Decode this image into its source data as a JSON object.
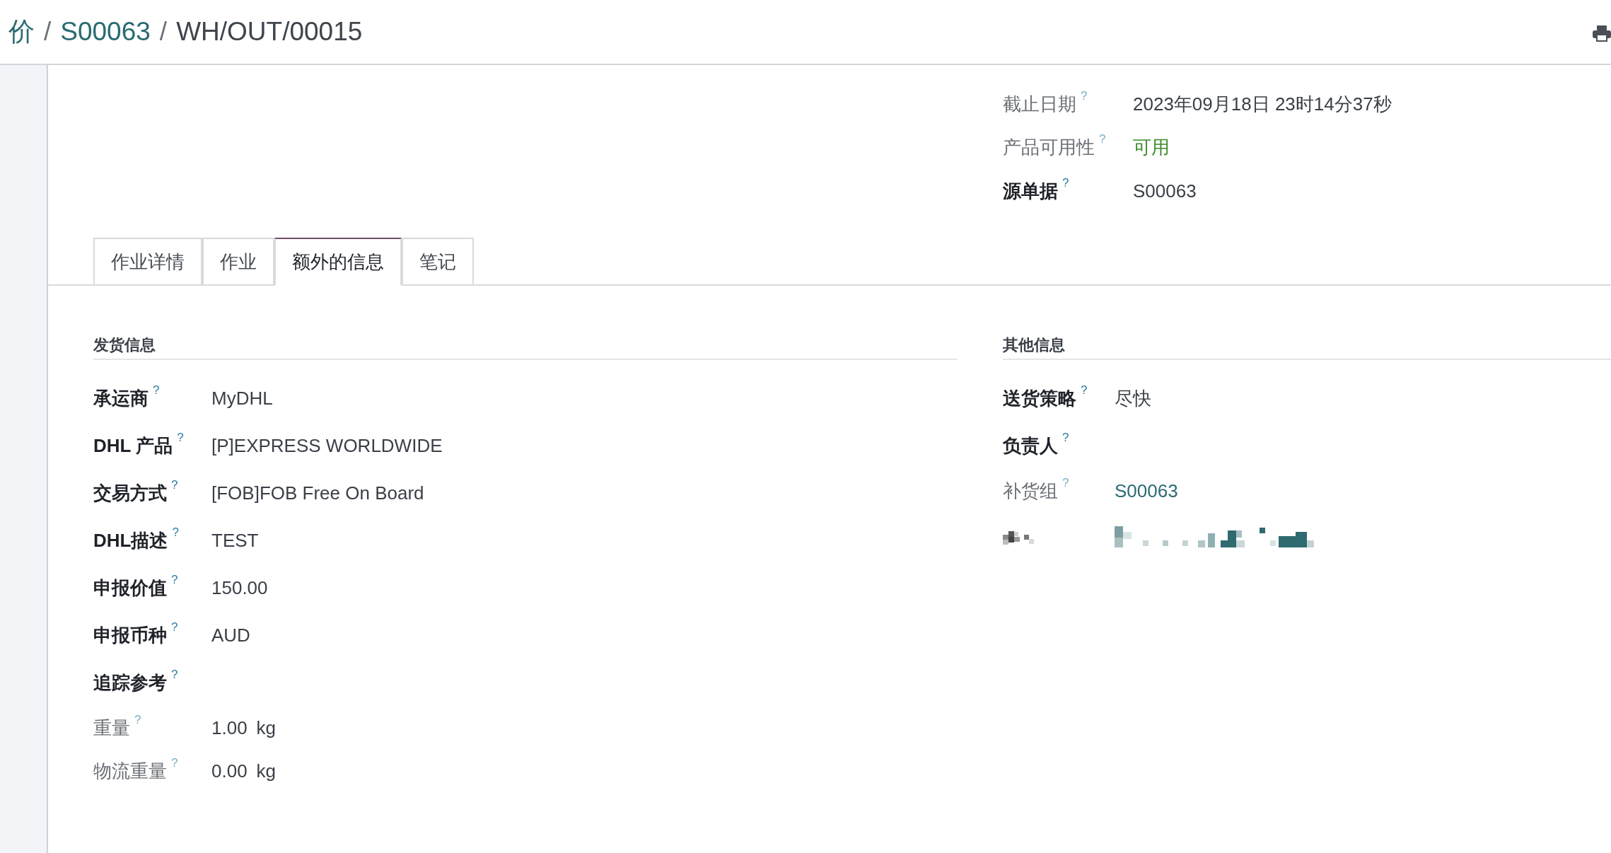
{
  "breadcrumbs": [
    {
      "kind": "link",
      "label": "价"
    },
    {
      "kind": "separator",
      "label": "/"
    },
    {
      "kind": "link",
      "label": "S00063"
    },
    {
      "kind": "separator",
      "label": "/"
    },
    {
      "kind": "current",
      "label": "WH/OUT/00015"
    }
  ],
  "header_fields": [
    {
      "kind": "text",
      "label": "截止日期",
      "tooltip": "?",
      "readonly": true,
      "value": "2023年09月18日 23时14分37秒"
    },
    {
      "kind": "status",
      "label": "产品可用性",
      "tooltip": "?",
      "readonly": true,
      "value": "可用"
    },
    {
      "kind": "text",
      "label": "源单据",
      "tooltip": "?",
      "readonly": false,
      "value": "S00063"
    }
  ],
  "tabs": [
    {
      "label": "作业详情",
      "selected": false
    },
    {
      "label": "作业",
      "selected": false
    },
    {
      "label": "额外的信息",
      "selected": true
    },
    {
      "label": "笔记",
      "selected": false
    }
  ],
  "sections": [
    {
      "title": "发货信息",
      "fields": [
        {
          "kind": "text",
          "label": "承运商",
          "tooltip": "?",
          "readonly": false,
          "value": "MyDHL"
        },
        {
          "kind": "text",
          "label": "DHL 产品",
          "tooltip": "?",
          "readonly": false,
          "value": "[P]EXPRESS WORLDWIDE"
        },
        {
          "kind": "text",
          "label": "交易方式",
          "tooltip": "?",
          "readonly": false,
          "value": "[FOB]FOB Free On Board"
        },
        {
          "kind": "text",
          "label": "DHL描述",
          "tooltip": "?",
          "readonly": false,
          "value": "TEST"
        },
        {
          "kind": "text",
          "label": "申报价值",
          "tooltip": "?",
          "readonly": false,
          "value": "150.00"
        },
        {
          "kind": "text",
          "label": "申报币种",
          "tooltip": "?",
          "readonly": false,
          "value": "AUD"
        },
        {
          "kind": "text",
          "label": "追踪参考",
          "tooltip": "?",
          "readonly": false
        },
        {
          "kind": "quantity",
          "label": "重量",
          "tooltip": "?",
          "readonly": true,
          "value": "1.00",
          "unit": "kg"
        },
        {
          "kind": "quantity",
          "label": "物流重量",
          "tooltip": "?",
          "readonly": true,
          "value": "0.00",
          "unit": "kg"
        }
      ]
    },
    {
      "title": "其他信息",
      "fields": [
        {
          "kind": "text",
          "label": "送货策略",
          "tooltip": "?",
          "readonly": false,
          "value": "尽快"
        },
        {
          "kind": "text",
          "label": "负责人",
          "tooltip": "?",
          "readonly": false
        },
        {
          "kind": "link",
          "label": "补货组",
          "tooltip": "?",
          "readonly": true,
          "value": "S00063"
        },
        {
          "kind": "redacted"
        }
      ]
    }
  ]
}
